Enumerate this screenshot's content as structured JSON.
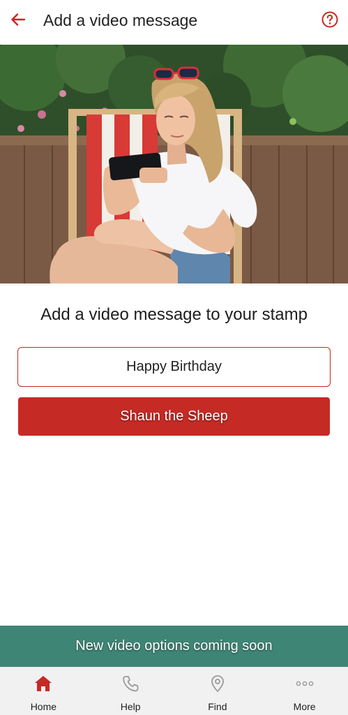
{
  "header": {
    "title": "Add a video message",
    "back_icon": "arrow-left-icon",
    "help_icon": "question-circle-icon"
  },
  "hero": {
    "image": "woman-in-deck-chair-with-phone"
  },
  "main": {
    "heading": "Add a video message to your stamp",
    "option_outline_label": "Happy Birthday",
    "option_filled_label": "Shaun the Sheep"
  },
  "banner": {
    "text": "New video options coming soon"
  },
  "bottom_nav": {
    "items": [
      {
        "label": "Home",
        "icon": "home-icon"
      },
      {
        "label": "Help",
        "icon": "phone-icon"
      },
      {
        "label": "Find",
        "icon": "location-pin-icon"
      },
      {
        "label": "More",
        "icon": "more-dots-icon"
      }
    ]
  },
  "colors": {
    "accent_red": "#c62a25",
    "banner_teal": "#3f8576",
    "nav_background": "#f1f1f1"
  }
}
